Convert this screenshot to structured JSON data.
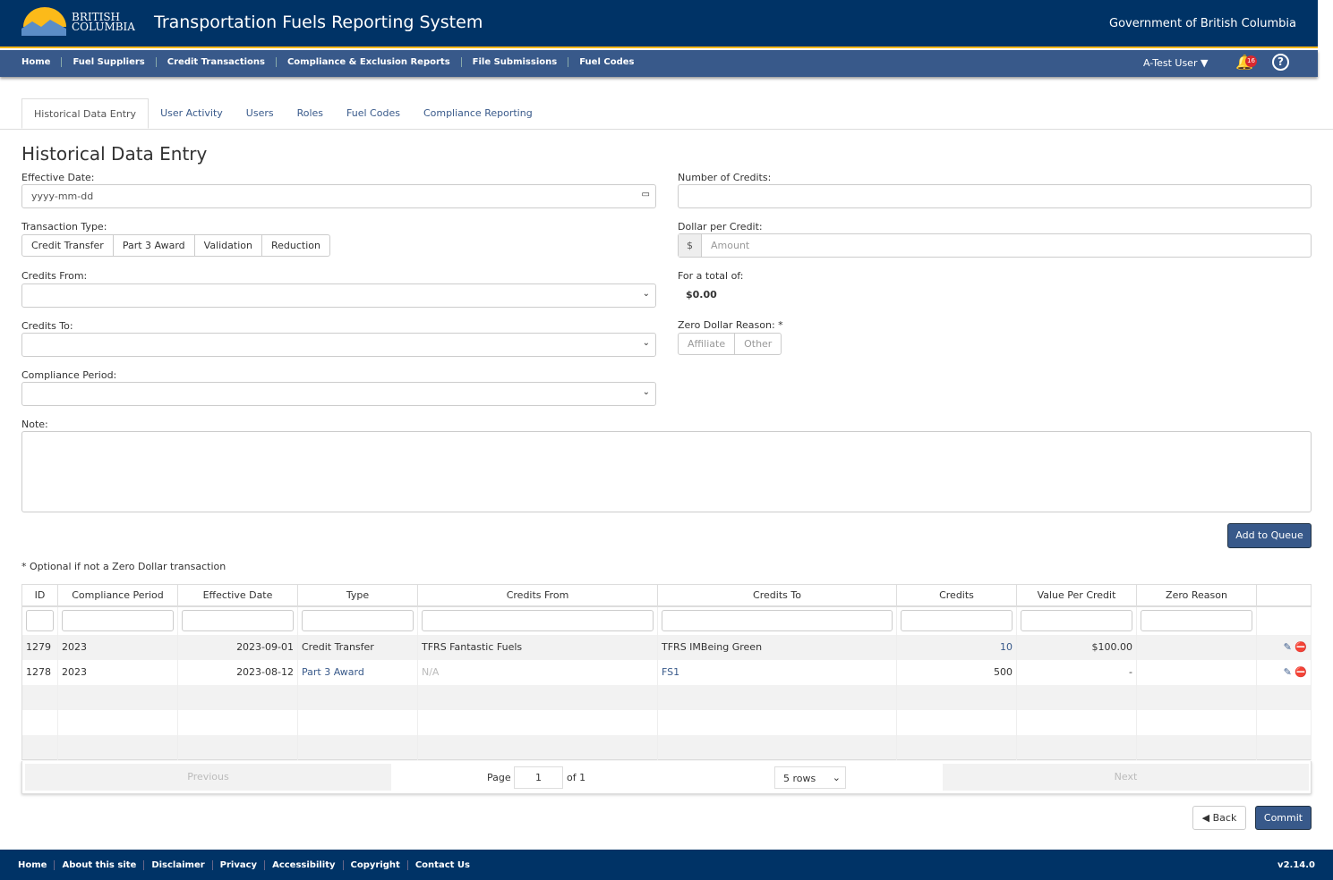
{
  "header": {
    "brand_line1": "BRITISH",
    "brand_line2": "COLUMBIA",
    "title": "Transportation Fuels Reporting System",
    "gov": "Government of British Columbia"
  },
  "nav": {
    "items": [
      "Home",
      "Fuel Suppliers",
      "Credit Transactions",
      "Compliance & Exclusion Reports",
      "File Submissions",
      "Fuel Codes"
    ],
    "user": "A-Test User",
    "notifications": "16"
  },
  "tabs": [
    "Historical Data Entry",
    "User Activity",
    "Users",
    "Roles",
    "Fuel Codes",
    "Compliance Reporting"
  ],
  "form": {
    "title": "Historical Data Entry",
    "effective_date_label": "Effective Date:",
    "effective_date_placeholder": "yyyy-mm-dd",
    "transaction_type_label": "Transaction Type:",
    "transaction_types": [
      "Credit Transfer",
      "Part 3 Award",
      "Validation",
      "Reduction"
    ],
    "credits_from_label": "Credits From:",
    "credits_to_label": "Credits To:",
    "compliance_period_label": "Compliance Period:",
    "note_label": "Note:",
    "num_credits_label": "Number of Credits:",
    "dollar_label": "Dollar per Credit:",
    "dollar_prefix": "$",
    "dollar_placeholder": "Amount",
    "total_label": "For a total of:",
    "total_value": "$0.00",
    "zero_reason_label": "Zero Dollar Reason: *",
    "zero_reasons": [
      "Affiliate",
      "Other"
    ],
    "add_button": "Add to Queue",
    "footnote": "* Optional if not a Zero Dollar transaction"
  },
  "table": {
    "headers": [
      "ID",
      "Compliance Period",
      "Effective Date",
      "Type",
      "Credits From",
      "Credits To",
      "Credits",
      "Value Per Credit",
      "Zero Reason",
      ""
    ],
    "rows": [
      [
        "1279",
        "2023",
        "2023-09-01",
        "Credit Transfer",
        "TFRS Fantastic Fuels",
        "TFRS IMBeing Green",
        "10",
        "$100.00",
        ""
      ],
      [
        "1278",
        "2023",
        "2023-08-12",
        "Part 3 Award",
        "N/A",
        "FS1",
        "500",
        "-",
        ""
      ]
    ]
  },
  "pager": {
    "previous": "Previous",
    "page_label": "Page",
    "page": "1",
    "of": "of 1",
    "rows": "5 rows",
    "next": "Next"
  },
  "actions": {
    "back": "Back",
    "commit": "Commit"
  },
  "footer": {
    "items": [
      "Home",
      "About this site",
      "Disclaimer",
      "Privacy",
      "Accessibility",
      "Copyright",
      "Contact Us"
    ],
    "version": "v2.14.0"
  }
}
